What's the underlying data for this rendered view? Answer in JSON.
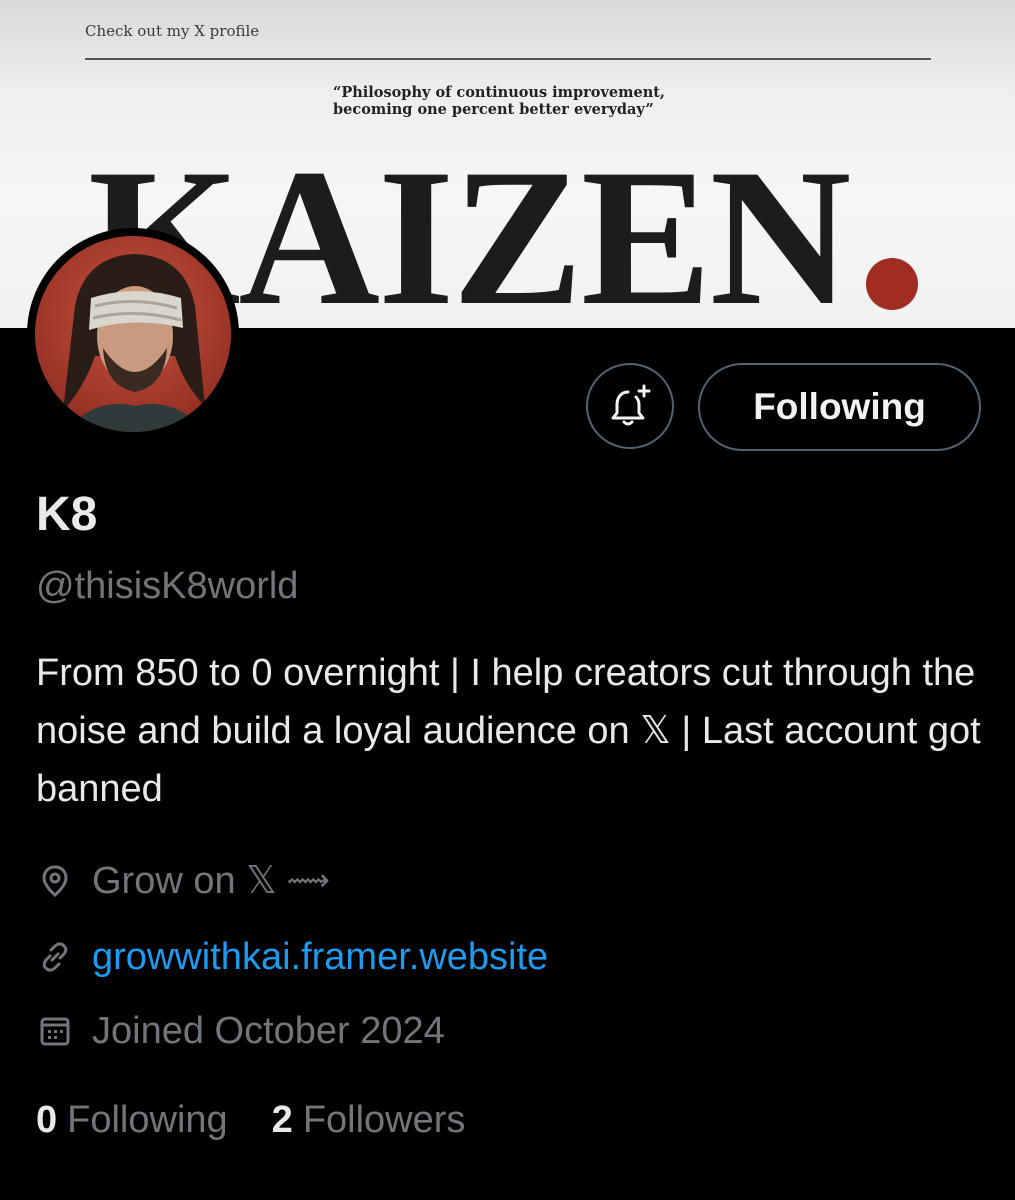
{
  "banner": {
    "caption": "Check out my X profile",
    "quote": "“Philosophy of continuous improvement,\nbecoming one percent better everyday”",
    "headline": "KAIZEN",
    "accent_color": "#a02c22"
  },
  "actions": {
    "notify_icon": "bell-plus-icon",
    "follow_label": "Following"
  },
  "profile": {
    "display_name": "K8",
    "handle": "@thisisK8world",
    "bio": "From 850 to 0 overnight | I help creators cut through the noise and build a loyal audience on 𝕏 | Last account got banned",
    "location": "Grow on 𝕏",
    "location_arrow": "⟿",
    "website": "growwithkai.framer.website",
    "joined": "Joined October 2024"
  },
  "stats": {
    "following_count": "0",
    "following_label": "Following",
    "followers_count": "2",
    "followers_label": "Followers"
  },
  "colors": {
    "background": "#000000",
    "primary_text": "#e7e9ea",
    "secondary_text": "#71767b",
    "link": "#1d9bf0",
    "button_border": "#536471"
  }
}
